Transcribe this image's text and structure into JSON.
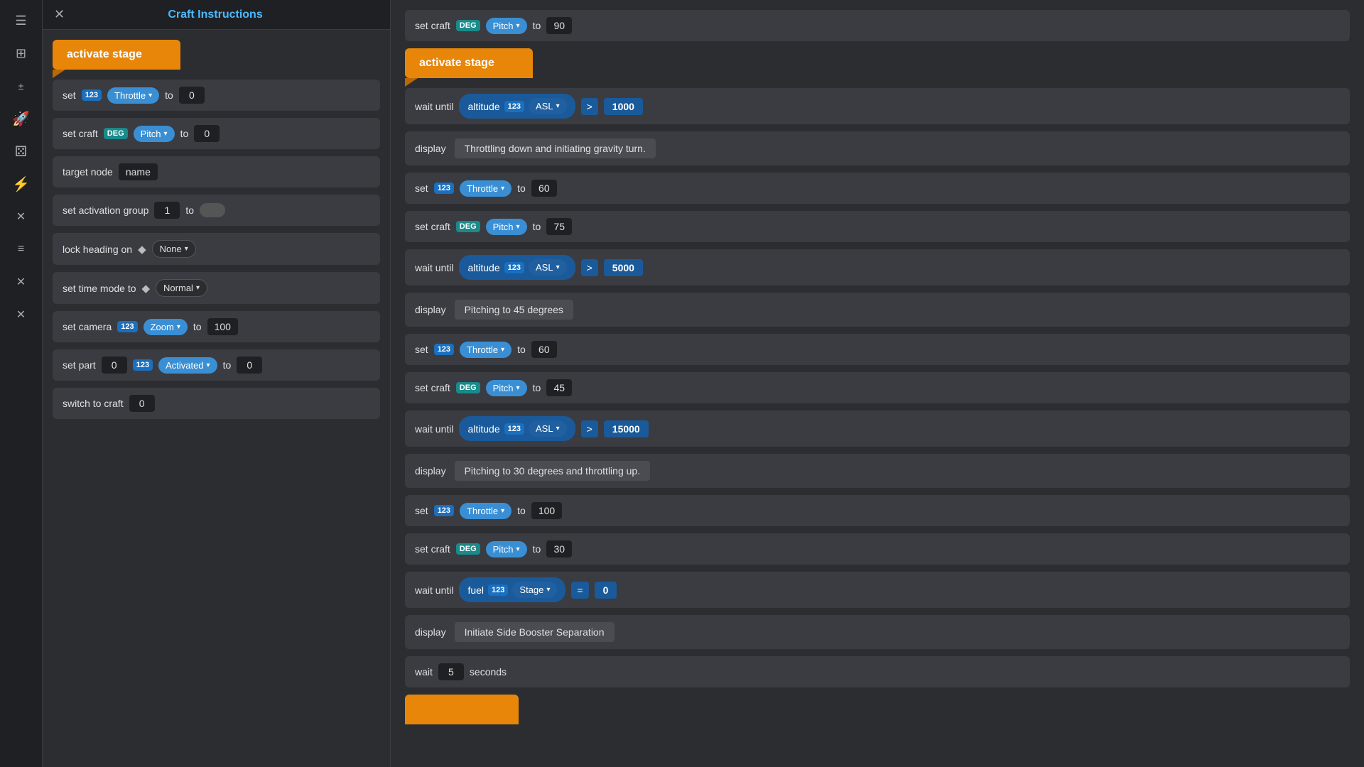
{
  "window": {
    "title": "Craft Instructions",
    "close_label": "✕"
  },
  "sidebar": {
    "icons": [
      {
        "name": "menu-icon",
        "glyph": "☰"
      },
      {
        "name": "grid-icon",
        "glyph": "⊞"
      },
      {
        "name": "math-icon",
        "glyph": "±"
      },
      {
        "name": "rocket-icon",
        "glyph": "🚀"
      },
      {
        "name": "dice-icon",
        "glyph": "⚄"
      },
      {
        "name": "bolt-icon",
        "glyph": "⚡"
      },
      {
        "name": "x-vars-icon",
        "glyph": "✕"
      },
      {
        "name": "list-icon",
        "glyph": "☰"
      },
      {
        "name": "x-icon2",
        "glyph": "✕"
      },
      {
        "name": "x-icon3",
        "glyph": "✕"
      }
    ]
  },
  "left_panel": {
    "activate_stage_label": "activate stage",
    "blocks": [
      {
        "type": "set_throttle",
        "prefix": "set",
        "badge": "123",
        "dropdown_label": "Throttle",
        "to_label": "to",
        "value": "0"
      },
      {
        "type": "set_craft_pitch",
        "prefix": "set craft",
        "badge": "DEG",
        "dropdown_label": "Pitch",
        "to_label": "to",
        "value": "0"
      },
      {
        "type": "target_node",
        "prefix": "target node",
        "value": "name"
      },
      {
        "type": "set_activation_group",
        "prefix": "set activation group",
        "value": "1",
        "to_label": "to"
      },
      {
        "type": "lock_heading",
        "prefix": "lock heading on",
        "diamond": "◆",
        "dropdown_label": "None"
      },
      {
        "type": "set_time_mode",
        "prefix": "set time mode to",
        "diamond": "◆",
        "dropdown_label": "Normal"
      },
      {
        "type": "set_camera",
        "prefix": "set camera",
        "badge": "123",
        "dropdown_label": "Zoom",
        "to_label": "to",
        "value": "100"
      },
      {
        "type": "set_part",
        "prefix": "set part",
        "value1": "0",
        "badge": "123",
        "dropdown_label": "Activated",
        "to_label": "to",
        "value2": "0"
      },
      {
        "type": "switch_to_craft",
        "prefix": "switch to craft",
        "value": "0"
      }
    ]
  },
  "right_panel": {
    "blocks": [
      {
        "type": "set_craft_pitch_top",
        "prefix": "set craft",
        "badge": "DEG",
        "dropdown_label": "Pitch",
        "to_label": "to",
        "value": "90"
      },
      {
        "type": "activate_stage",
        "label": "activate stage"
      },
      {
        "type": "wait_until_altitude_1",
        "prefix": "wait until",
        "cond_badge": "123",
        "cond_label": "altitude",
        "cond_dropdown": "ASL",
        "op": ">",
        "val": "1000"
      },
      {
        "type": "display",
        "prefix": "display",
        "text": "Throttling down and initiating gravity turn."
      },
      {
        "type": "set_throttle_60",
        "prefix": "set",
        "badge": "123",
        "dropdown_label": "Throttle",
        "to_label": "to",
        "value": "60"
      },
      {
        "type": "set_craft_pitch_75",
        "prefix": "set craft",
        "badge": "DEG",
        "dropdown_label": "Pitch",
        "to_label": "to",
        "value": "75"
      },
      {
        "type": "wait_until_altitude_2",
        "prefix": "wait until",
        "cond_badge": "123",
        "cond_label": "altitude",
        "cond_dropdown": "ASL",
        "op": ">",
        "val": "5000"
      },
      {
        "type": "display2",
        "prefix": "display",
        "text": "Pitching to 45 degrees"
      },
      {
        "type": "set_throttle_60b",
        "prefix": "set",
        "badge": "123",
        "dropdown_label": "Throttle",
        "to_label": "to",
        "value": "60"
      },
      {
        "type": "set_craft_pitch_45",
        "prefix": "set craft",
        "badge": "DEG",
        "dropdown_label": "Pitch",
        "to_label": "to",
        "value": "45"
      },
      {
        "type": "wait_until_altitude_3",
        "prefix": "wait until",
        "cond_badge": "123",
        "cond_label": "altitude",
        "cond_dropdown": "ASL",
        "op": ">",
        "val": "15000"
      },
      {
        "type": "display3",
        "prefix": "display",
        "text": "Pitching to 30 degrees and throttling up."
      },
      {
        "type": "set_throttle_100",
        "prefix": "set",
        "badge": "123",
        "dropdown_label": "Throttle",
        "to_label": "to",
        "value": "100"
      },
      {
        "type": "set_craft_pitch_30",
        "prefix": "set craft",
        "badge": "DEG",
        "dropdown_label": "Pitch",
        "to_label": "to",
        "value": "30"
      },
      {
        "type": "wait_until_fuel",
        "prefix": "wait until",
        "cond_badge": "123",
        "cond_label": "fuel",
        "cond_dropdown": "Stage",
        "op": "=",
        "val": "0"
      },
      {
        "type": "display4",
        "prefix": "display",
        "text": "Initiate Side Booster Separation"
      },
      {
        "type": "wait_seconds",
        "prefix": "wait",
        "value": "5",
        "suffix": "seconds"
      }
    ]
  },
  "colors": {
    "orange": "#e8860a",
    "blue_badge": "#1a6fbf",
    "teal_badge": "#1a8a8a",
    "blue_dropdown": "#3a8fd4",
    "dark_bg": "#1e2024",
    "panel_bg": "#2b2d31",
    "block_bg": "#3a3c42",
    "cond_bg": "#1a5a9a"
  }
}
